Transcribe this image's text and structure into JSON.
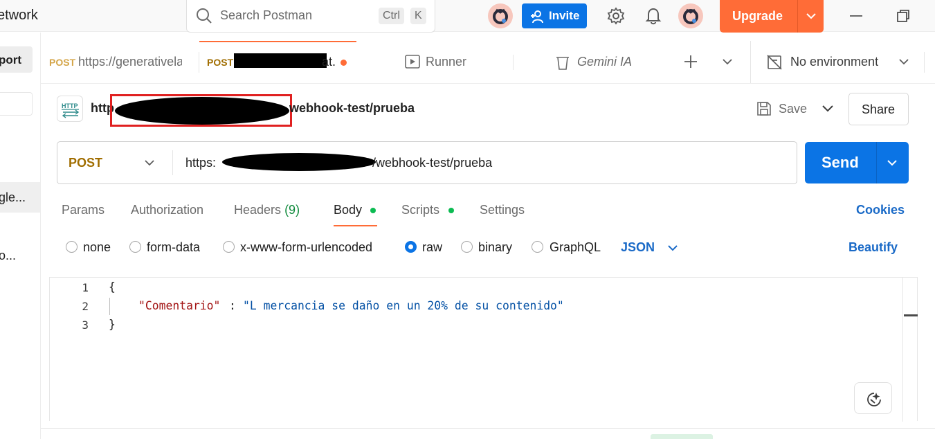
{
  "app": {
    "brand_fragment": "etwork",
    "search": {
      "placeholder": "Search Postman",
      "shortcut_key1": "Ctrl",
      "shortcut_key2": "K"
    },
    "invite_label": "Invite",
    "upgrade_label": "Upgrade"
  },
  "sidebar": {
    "import_fragment": "port",
    "selected_item_fragment": "gle...",
    "item2_fragment": "o..."
  },
  "tabs": [
    {
      "method": "POST",
      "label": "https://generativela"
    },
    {
      "method": "POST",
      "label_tail": "at.",
      "unsaved": true
    },
    {
      "label": "Runner",
      "icon": "play-icon"
    },
    {
      "label": "Gemini IA",
      "icon": "trash-icon"
    }
  ],
  "environment": {
    "label": "No environment"
  },
  "request": {
    "badge": "HTTP",
    "title_start": "http",
    "title_end": "webhook-test/prueba",
    "save_label": "Save",
    "share_label": "Share",
    "method": "POST",
    "url_start": "https:",
    "url_end": "/webhook-test/prueba",
    "send_label": "Send"
  },
  "request_tabs": {
    "params": "Params",
    "authorization": "Authorization",
    "headers": "Headers",
    "headers_count": "(9)",
    "body": "Body",
    "scripts": "Scripts",
    "settings": "Settings",
    "cookies": "Cookies"
  },
  "body_types": {
    "none": "none",
    "form_data": "form-data",
    "urlencoded": "x-www-form-urlencoded",
    "raw": "raw",
    "binary": "binary",
    "graphql": "GraphQL",
    "selected": "raw",
    "format": "JSON",
    "beautify": "Beautify"
  },
  "editor": {
    "line_numbers": [
      "1",
      "2",
      "3"
    ],
    "open_brace": "{",
    "key": "\"Comentario\"",
    "colon": ":",
    "value": "\"L mercancia se daño en un 20% de su contenido\"",
    "close_brace": "}"
  },
  "colors": {
    "accent_orange": "#ff6c37",
    "primary_blue": "#0b74e5",
    "post_method": "#a06d00",
    "json_key": "#a31515",
    "json_value": "#0451a5"
  }
}
